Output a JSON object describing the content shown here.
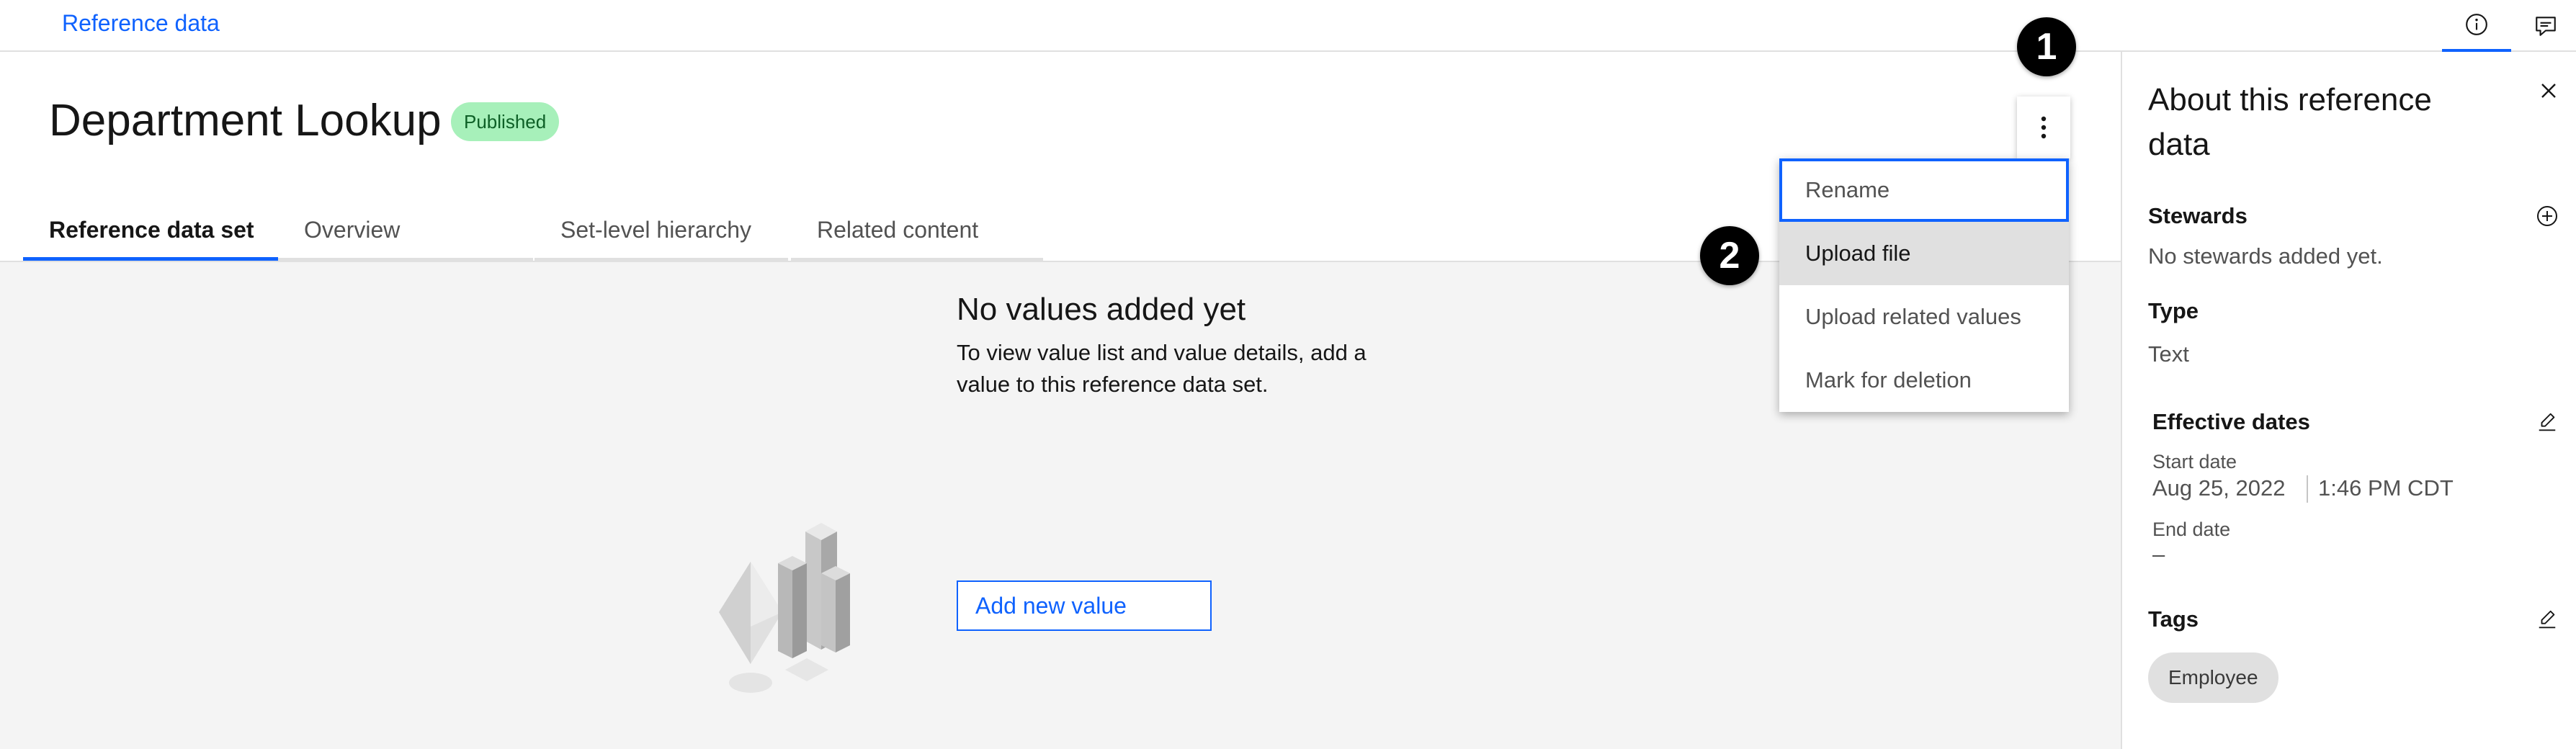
{
  "breadcrumb": {
    "label": "Reference data"
  },
  "header": {
    "title": "Department Lookup",
    "status_badge": "Published"
  },
  "tabs": [
    {
      "label": "Reference data set",
      "active": true
    },
    {
      "label": "Overview"
    },
    {
      "label": "Set-level hierarchy"
    },
    {
      "label": "Related content"
    }
  ],
  "overflow_menu": {
    "items": [
      {
        "label": "Rename",
        "state": "focused"
      },
      {
        "label": "Upload file",
        "state": "hover"
      },
      {
        "label": "Upload related values"
      },
      {
        "label": "Mark for deletion"
      }
    ]
  },
  "callouts": [
    "1",
    "2"
  ],
  "empty_state": {
    "title": "No values added yet",
    "description": "To view value list and value details, add a value to this reference data set.",
    "button": "Add new value"
  },
  "side_panel": {
    "title": "About this reference data",
    "stewards_label": "Stewards",
    "stewards_value": "No stewards added yet.",
    "type_label": "Type",
    "type_value": "Text",
    "effective_dates_label": "Effective dates",
    "start_date_label": "Start date",
    "start_date": "Aug 25, 2022",
    "start_time": "1:46 PM CDT",
    "end_date_label": "End date",
    "end_date": "–",
    "tags_label": "Tags",
    "tags": [
      "Employee"
    ]
  },
  "colors": {
    "accent": "#0f62fe",
    "badge_bg": "#a7f0ba",
    "badge_text": "#0e6027",
    "content_bg": "#f4f4f4"
  },
  "icons": [
    "info-icon",
    "chat-icon",
    "overflow-menu-icon",
    "close-icon",
    "add-circle-icon",
    "edit-icon"
  ]
}
